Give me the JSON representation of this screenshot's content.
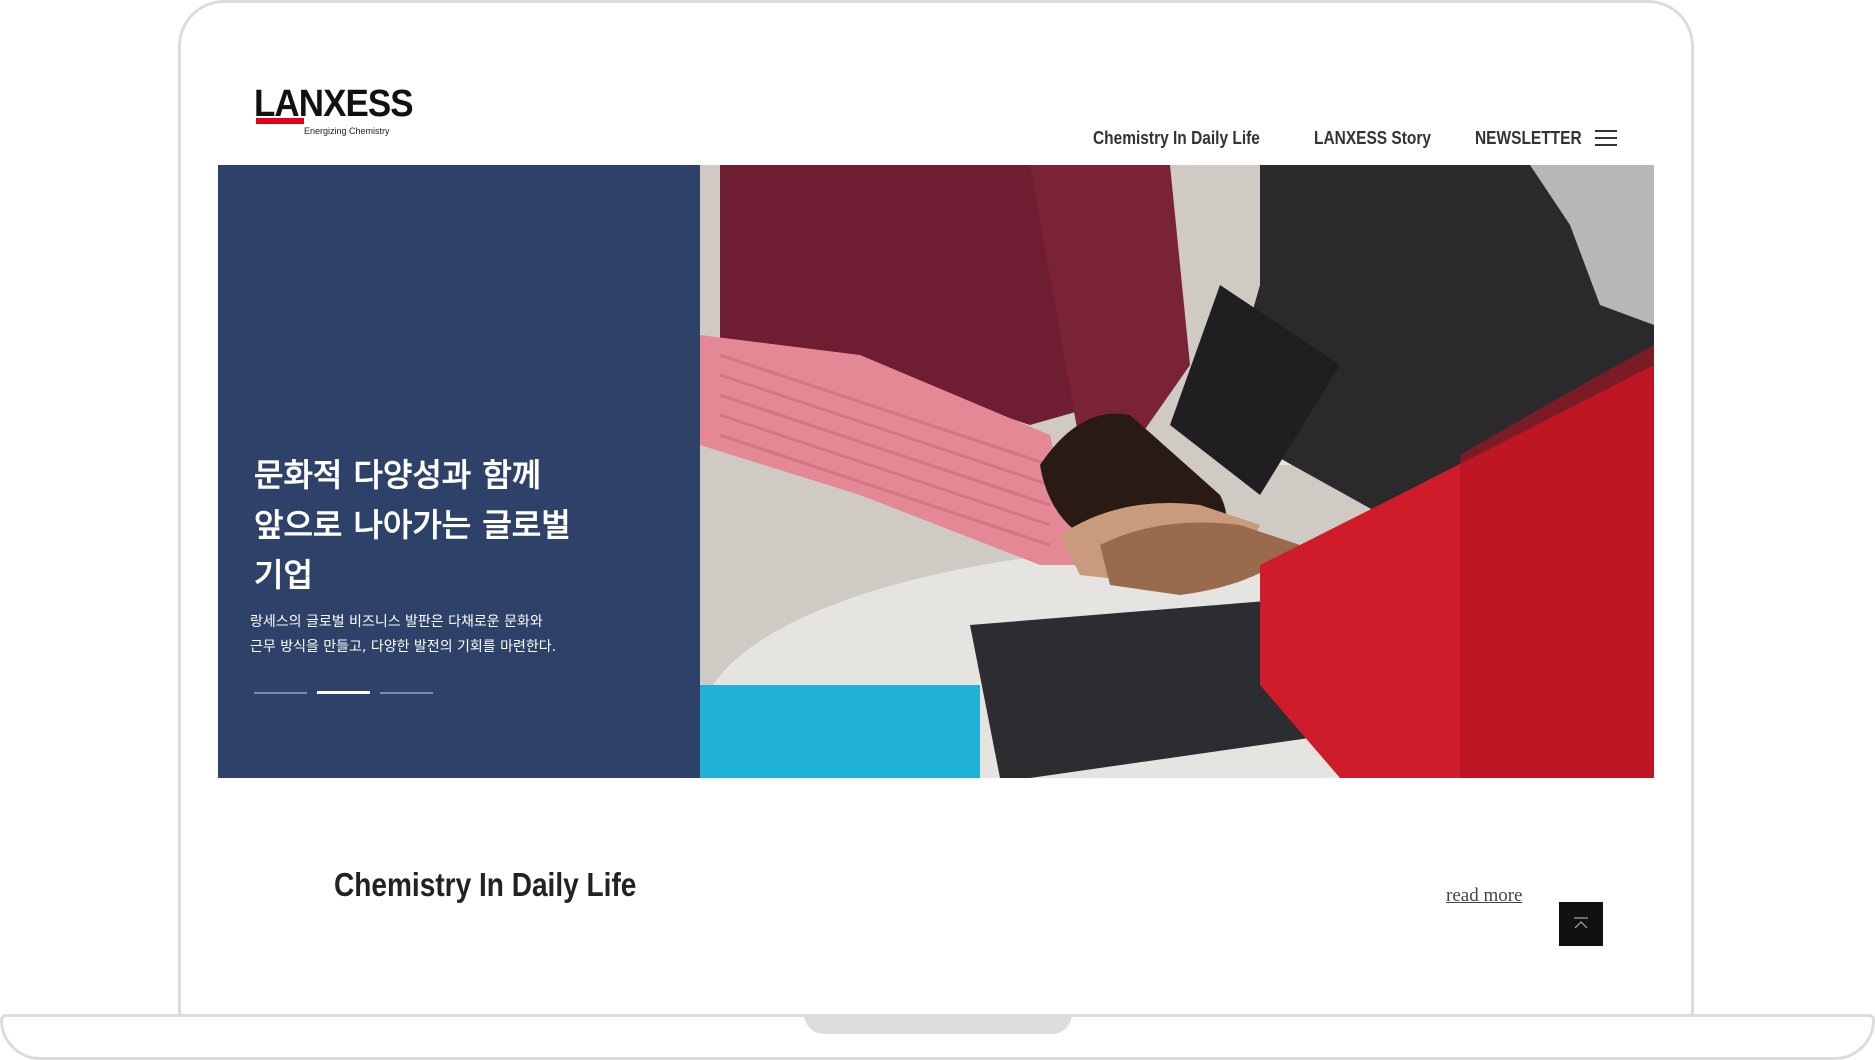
{
  "brand": {
    "name": "LANXESS",
    "tagline": "Energizing Chemistry",
    "accent_color": "#e3001b"
  },
  "nav": {
    "items": [
      {
        "label": "Chemistry In Daily Life"
      },
      {
        "label": "LANXESS Story"
      },
      {
        "label": "NEWSLETTER"
      }
    ],
    "menu_icon": "hamburger-menu-icon"
  },
  "hero": {
    "panel_color": "#2e4269",
    "title_lines": [
      "문화적 다양성과 함께",
      "앞으로 나아가는 글로벌",
      "기업"
    ],
    "subtitle_lines": [
      "랑세스의 글로벌 비즈니스 발판은 다채로운 문화와",
      "근무 방식을 만들고, 다양한 발전의 기회를 마련한다."
    ],
    "slides_total": 3,
    "active_slide": 2
  },
  "section": {
    "title": "Chemistry In Daily Life",
    "read_more": "read more"
  },
  "scroll_top_icon": "arrow-up-icon"
}
